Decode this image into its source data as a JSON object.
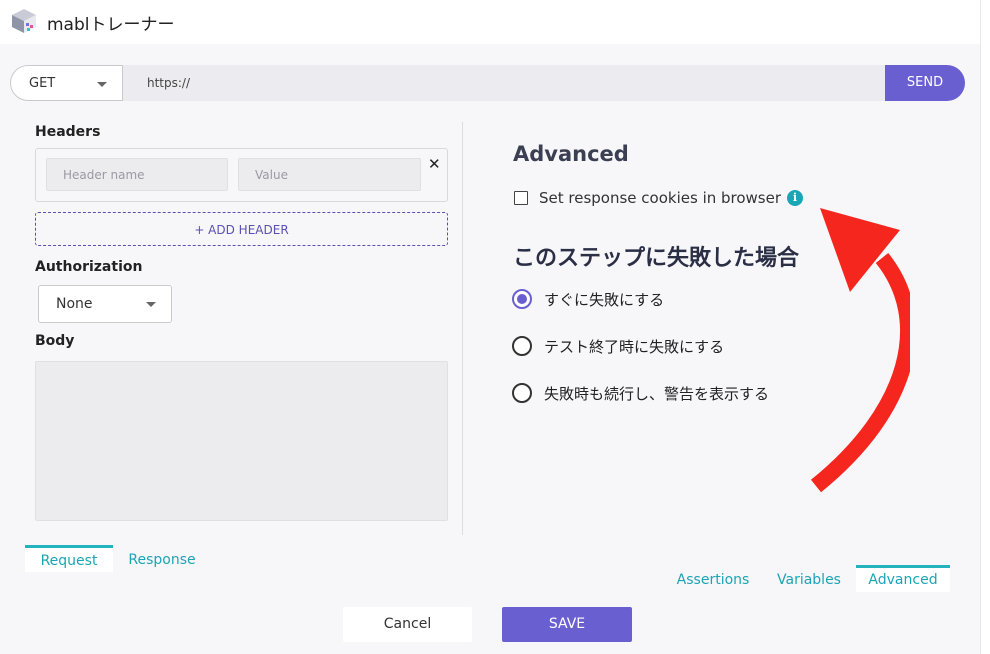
{
  "app": {
    "title": "mablトレーナー"
  },
  "request": {
    "method": "GET",
    "url": "https://",
    "send_label": "SEND"
  },
  "headers": {
    "title": "Headers",
    "name_placeholder": "Header name",
    "value_placeholder": "Value",
    "add_label": "+ ADD HEADER"
  },
  "authorization": {
    "title": "Authorization",
    "value": "None"
  },
  "body": {
    "title": "Body"
  },
  "advanced": {
    "title": "Advanced",
    "cookies_label": "Set response cookies in browser",
    "cookies_checked": false
  },
  "failure": {
    "title": "このステップに失敗した場合",
    "options": [
      {
        "label": "すぐに失敗にする",
        "selected": true
      },
      {
        "label": "テスト終了時に失敗にする",
        "selected": false
      },
      {
        "label": "失敗時も続行し、警告を表示する",
        "selected": false
      }
    ]
  },
  "tabs_left": [
    {
      "label": "Request",
      "active": true
    },
    {
      "label": "Response",
      "active": false
    }
  ],
  "tabs_right": [
    {
      "label": "Assertions",
      "active": false
    },
    {
      "label": "Variables",
      "active": false
    },
    {
      "label": "Advanced",
      "active": true
    }
  ],
  "footer": {
    "cancel_label": "Cancel",
    "save_label": "SAVE"
  },
  "colors": {
    "accent": "#6a5fd1",
    "tab_teal": "#1ba5b4",
    "arrow_red": "#f5261e"
  }
}
